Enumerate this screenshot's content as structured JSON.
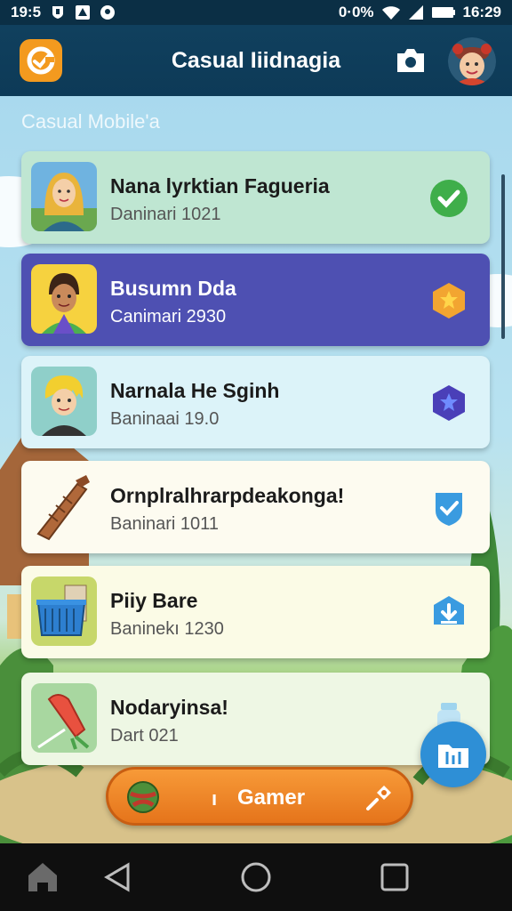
{
  "status_bar": {
    "time_left": "19:5",
    "indicators": "0·0%",
    "time_right": "16:29",
    "icons": [
      "shield-icon",
      "drive-icon",
      "location-icon",
      "wifi-icon",
      "signal-icon",
      "battery-icon"
    ]
  },
  "app_bar": {
    "title": "Casual Iiidnagia",
    "logo_icon": "game-logo-icon",
    "camera_icon": "camera-icon",
    "avatar_icon": "profile-avatar"
  },
  "section_label": "Casual Mobile'a",
  "cards": [
    {
      "title": "Nana lyrktian Fagueria",
      "subtitle": "Daninari 1021",
      "badge": "check-icon",
      "bg": "#bfe6d2",
      "active": false
    },
    {
      "title": "Busumn Dda",
      "subtitle": "Canimari 2930",
      "badge": "star-badge-icon",
      "bg": "#4e50b2",
      "active": true
    },
    {
      "title": "Narnala He Sginh",
      "subtitle": "Baninaai 19.0",
      "badge": "star-badge-icon",
      "bg": "#dcf3f9",
      "active": false
    },
    {
      "title": "Ornplralhrarpdeakonga!",
      "subtitle": "Baninari 1011",
      "badge": "check-shield-icon",
      "bg": "#fdfbf0",
      "active": false
    },
    {
      "title": "Piiy Bare",
      "subtitle": "Baninekı 1230",
      "badge": "download-badge-icon",
      "bg": "#fbfbe6",
      "active": false
    },
    {
      "title": "Nodaryinsa!",
      "subtitle": "Dart 021",
      "badge": "jar-icon",
      "bg": "#eef7e4",
      "active": false
    }
  ],
  "bottom_pill": {
    "dot": "ı",
    "label": "Gamer",
    "left_icon": "ball-icon",
    "right_icon": "pin-icon"
  },
  "fab_icon": "folder-icon",
  "nav": [
    "home-icon",
    "back-icon",
    "home-circle-icon",
    "recents-icon"
  ],
  "colors": {
    "app_bar": "#0d3a57",
    "accent_orange": "#f39a1f",
    "active_card": "#4e50b2",
    "fab": "#2e8fd6"
  }
}
